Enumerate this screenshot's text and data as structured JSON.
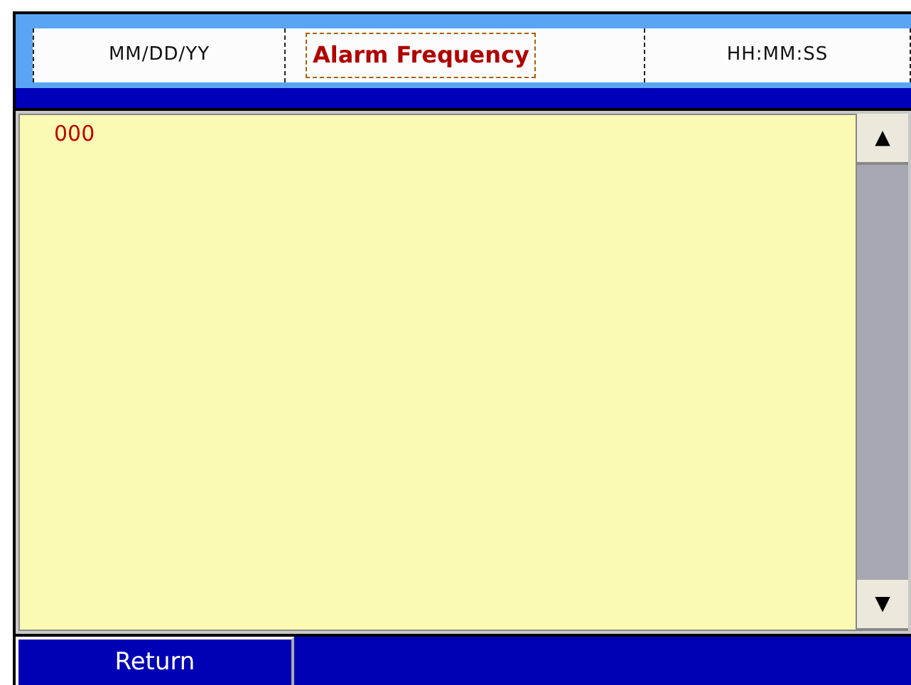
{
  "header": {
    "date": "MM/DD/YY",
    "title": "Alarm Frequency",
    "time": "HH:MM:SS"
  },
  "list": {
    "rows": [
      "000"
    ]
  },
  "scrollbar": {
    "up": "▲",
    "down": "▼"
  },
  "footer": {
    "buttons": [
      "Return"
    ]
  }
}
